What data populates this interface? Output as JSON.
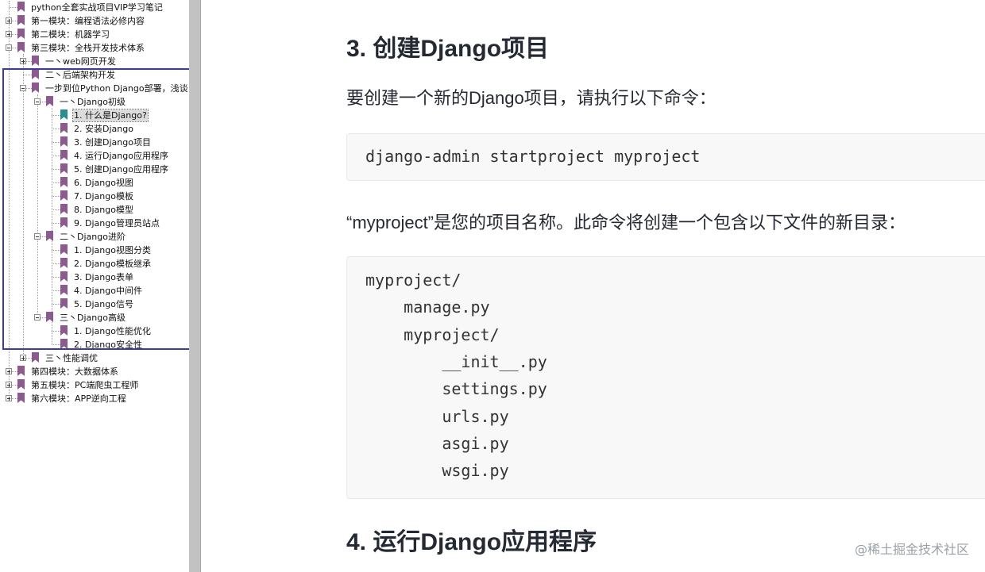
{
  "sidebar": {
    "items": [
      {
        "label": "python全套实战项目VIP学习笔记",
        "level": 0,
        "expander": "none",
        "selected": false
      },
      {
        "label": "第一模块：编程语法必修内容",
        "level": 0,
        "expander": "plus",
        "selected": false
      },
      {
        "label": "第二模块：机器学习",
        "level": 0,
        "expander": "plus",
        "selected": false
      },
      {
        "label": "第三模块：全栈开发技术体系",
        "level": 0,
        "expander": "minus",
        "selected": false
      },
      {
        "label": "一丶web网页开发",
        "level": 1,
        "expander": "plus",
        "selected": false
      },
      {
        "label": "二丶后端架构开发",
        "level": 1,
        "expander": "none",
        "selected": false
      },
      {
        "label": "一步到位Python Django部署，浅谈",
        "level": 1,
        "expander": "minus",
        "selected": false
      },
      {
        "label": "一丶Django初级",
        "level": 2,
        "expander": "minus",
        "selected": false
      },
      {
        "label": "1. 什么是Django?",
        "level": 3,
        "expander": "none",
        "selected": true
      },
      {
        "label": "2. 安装Django",
        "level": 3,
        "expander": "none",
        "selected": false
      },
      {
        "label": "3. 创建Django项目",
        "level": 3,
        "expander": "none",
        "selected": false
      },
      {
        "label": "4. 运行Django应用程序",
        "level": 3,
        "expander": "none",
        "selected": false
      },
      {
        "label": "5. 创建Django应用程序",
        "level": 3,
        "expander": "none",
        "selected": false
      },
      {
        "label": "6. Django视图",
        "level": 3,
        "expander": "none",
        "selected": false
      },
      {
        "label": "7. Django模板",
        "level": 3,
        "expander": "none",
        "selected": false
      },
      {
        "label": "8. Django模型",
        "level": 3,
        "expander": "none",
        "selected": false
      },
      {
        "label": "9. Django管理员站点",
        "level": 3,
        "expander": "none",
        "selected": false
      },
      {
        "label": "二丶Django进阶",
        "level": 2,
        "expander": "minus",
        "selected": false
      },
      {
        "label": "1. Django视图分类",
        "level": 3,
        "expander": "none",
        "selected": false
      },
      {
        "label": "2. Django模板继承",
        "level": 3,
        "expander": "none",
        "selected": false
      },
      {
        "label": "3. Django表单",
        "level": 3,
        "expander": "none",
        "selected": false
      },
      {
        "label": "4. Django中间件",
        "level": 3,
        "expander": "none",
        "selected": false
      },
      {
        "label": "5. Django信号",
        "level": 3,
        "expander": "none",
        "selected": false
      },
      {
        "label": "三丶Django高级",
        "level": 2,
        "expander": "minus",
        "selected": false
      },
      {
        "label": "1. Django性能优化",
        "level": 3,
        "expander": "none",
        "selected": false
      },
      {
        "label": "2. Django安全性",
        "level": 3,
        "expander": "none",
        "selected": false
      },
      {
        "label": "三丶性能调优",
        "level": 1,
        "expander": "plus",
        "selected": false
      },
      {
        "label": "第四模块：大数据体系",
        "level": 0,
        "expander": "plus",
        "selected": false
      },
      {
        "label": "第五模块：PC端爬虫工程师",
        "level": 0,
        "expander": "plus",
        "selected": false
      },
      {
        "label": "第六模块：APP逆向工程",
        "level": 0,
        "expander": "plus",
        "selected": false
      }
    ]
  },
  "content": {
    "heading_3": "3. 创建Django项目",
    "para_1": "要创建一个新的Django项目，请执行以下命令：",
    "code_1": [
      "django-admin startproject myproject"
    ],
    "para_2": "“myproject”是您的项目名称。此命令将创建一个包含以下文件的新目录：",
    "code_2": [
      "myproject/",
      "    manage.py",
      "    myproject/",
      "        __init__.py",
      "        settings.py",
      "        urls.py",
      "        asgi.py",
      "        wsgi.py"
    ],
    "heading_4": "4. 运行Django应用程序"
  },
  "watermark": "@稀土掘金技术社区",
  "colors": {
    "bookmark": "#8c5a8f",
    "bookmark_selected": "#2a8c8c",
    "highlight_box": "#3d3ba0",
    "heading_text": "#252933",
    "code_bg": "#f8f8f8"
  },
  "icons": {
    "bookmark": "bookmark-icon",
    "expand": "plus-box-icon",
    "collapse": "minus-box-icon"
  }
}
